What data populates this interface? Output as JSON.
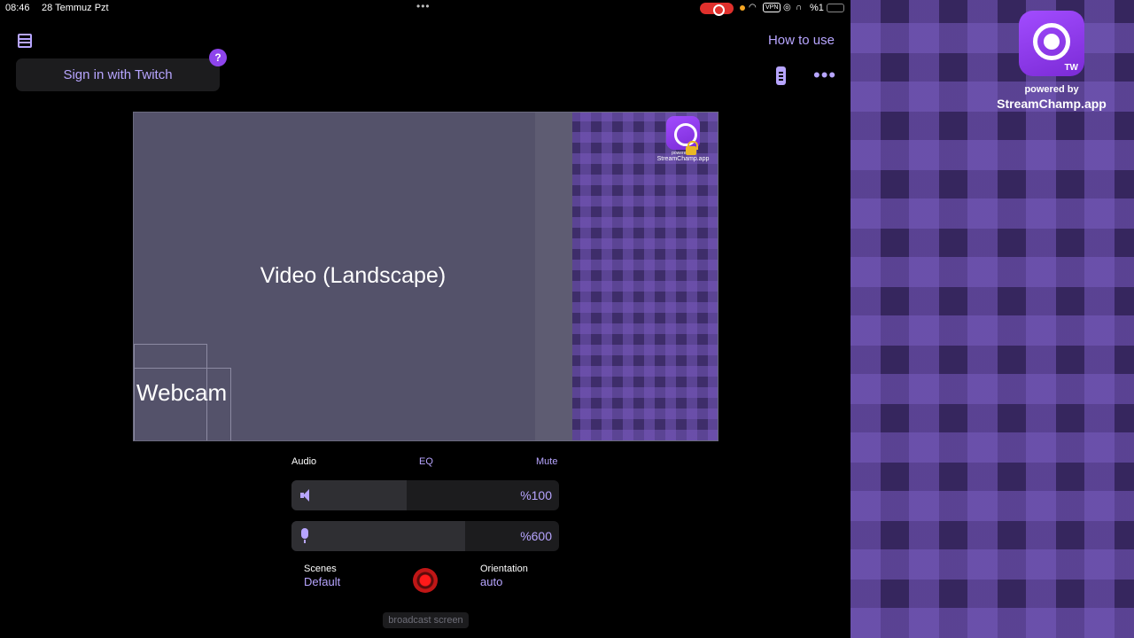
{
  "status_bar": {
    "time": "08:46",
    "date": "28 Temmuz Pzt",
    "multitask_dots": "•••",
    "vpn": "VPN",
    "battery_text": "%1"
  },
  "header": {
    "sign_in_label": "Sign in with Twitch",
    "help_badge": "?",
    "how_to_use_label": "How to use",
    "more_menu": "•••"
  },
  "preview": {
    "video_label": "Video (Landscape)",
    "webcam_label": "Webcam",
    "mini_powered": "powered by",
    "mini_site": "StreamChamp.app"
  },
  "brand": {
    "badge": "TW",
    "powered_by": "powered by",
    "site": "StreamChamp.app"
  },
  "audio": {
    "title": "Audio",
    "eq_label": "EQ",
    "mute_label": "Mute",
    "volume_value": "%100",
    "volume_level": 0.43,
    "mic_value": "%600",
    "mic_level": 0.65
  },
  "settings": {
    "scenes_label": "Scenes",
    "scenes_value": "Default",
    "orientation_label": "Orientation",
    "orientation_value": "auto"
  },
  "footer": {
    "broadcast_label": "broadcast screen"
  },
  "colors": {
    "accent": "#b7a5ff",
    "brand_purple": "#8e44ec",
    "record_red": "#ff1a1a"
  }
}
